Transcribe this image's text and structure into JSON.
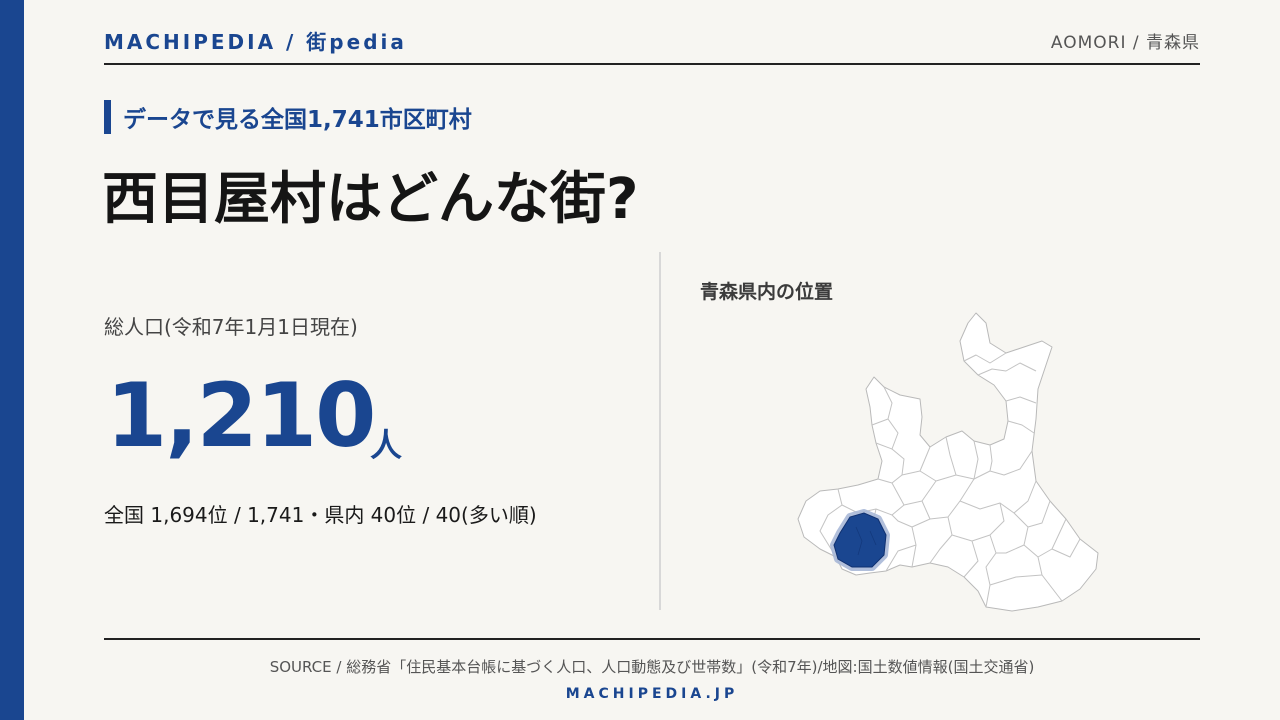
{
  "header": {
    "brand": "MACHIPEDIA / 街pedia",
    "region": "AOMORI / 青森県"
  },
  "kicker": "データで見る全国1,741市区町村",
  "title": "西目屋村はどんな街?",
  "population": {
    "label": "総人口(令和7年1月1日現在)",
    "value": "1,210",
    "unit": "人",
    "rank": "全国 1,694位 / 1,741・県内 40位 / 40(多い順)"
  },
  "map": {
    "label": "青森県内の位置"
  },
  "footer": {
    "source": "SOURCE / 総務省「住民基本台帳に基づく人口、人口動態及び世帯数」(令和7年)/地図:国土数値情報(国土交通省)",
    "site": "MACHIPEDIA.JP"
  },
  "colors": {
    "accent": "#1a4690",
    "background": "#f7f6f2"
  }
}
